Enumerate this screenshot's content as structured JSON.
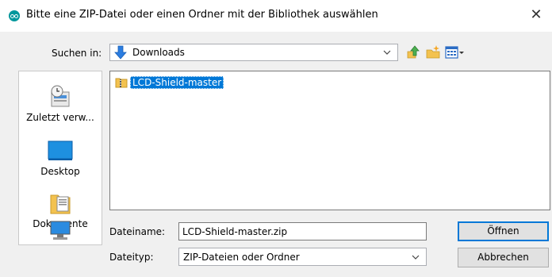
{
  "window": {
    "title": "Bitte eine ZIP-Datei oder einen Ordner mit der Bibliothek auswählen",
    "close_glyph": "✕"
  },
  "lookin": {
    "label": "Suchen in:",
    "value": "Downloads",
    "icon": "down-arrow-folder-icon"
  },
  "toolbar": {
    "icons": [
      "up-one-level-icon",
      "new-folder-icon",
      "view-menu-icon"
    ]
  },
  "places": [
    {
      "label": "Zuletzt verw...",
      "icon": "recent-items-icon"
    },
    {
      "label": "Desktop",
      "icon": "desktop-icon"
    },
    {
      "label": "Dokumente",
      "icon": "documents-icon"
    },
    {
      "label": "",
      "icon": "computer-icon"
    }
  ],
  "files": [
    {
      "name": "LCD-Shield-master",
      "icon": "zip-folder-icon",
      "selected": true
    }
  ],
  "filename": {
    "label": "Dateiname:",
    "value": "LCD-Shield-master.zip"
  },
  "filetype": {
    "label": "Dateityp:",
    "value": "ZIP-Dateien oder Ordner"
  },
  "buttons": {
    "open": "Öffnen",
    "cancel": "Abbrechen"
  },
  "colors": {
    "accent": "#0078d7",
    "arduino": "#00979c"
  }
}
